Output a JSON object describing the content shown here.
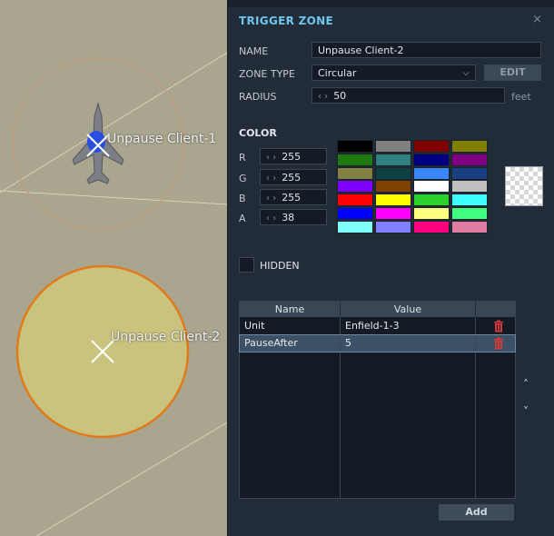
{
  "map": {
    "zones": [
      {
        "label": "Unpause Client-1"
      },
      {
        "label": "Unpause Client-2"
      }
    ]
  },
  "panel": {
    "title": "TRIGGER ZONE",
    "close_glyph": "×",
    "name_label": "NAME",
    "name_value": "Unpause Client-2",
    "zone_type_label": "ZONE TYPE",
    "zone_type_value": "Circular",
    "edit_label": "EDIT",
    "radius_label": "RADIUS",
    "radius_value": "50",
    "radius_unit": "feet",
    "color_label": "COLOR",
    "channels": [
      {
        "label": "R",
        "value": "255"
      },
      {
        "label": "G",
        "value": "255"
      },
      {
        "label": "B",
        "value": "255"
      },
      {
        "label": "A",
        "value": "38"
      }
    ],
    "palette": [
      "#000000",
      "#808080",
      "#800000",
      "#808000",
      "#1f7a12",
      "#2e8080",
      "#000080",
      "#800080",
      "#808040",
      "#0d4040",
      "#3a86ff",
      "#1a3f80",
      "#8000ff",
      "#804000",
      "#ffffff",
      "#c0c0c0",
      "#ff0000",
      "#ffff00",
      "#2ad12a",
      "#40ffff",
      "#0000ff",
      "#ff00ff",
      "#ffff80",
      "#40ff80",
      "#80ffff",
      "#8080ff",
      "#ff0080",
      "#e07aa0"
    ],
    "hidden_label": "HIDDEN",
    "table": {
      "columns": [
        "Name",
        "Value"
      ],
      "rows": [
        {
          "name": "Unit",
          "value": "Enfield-1-3"
        },
        {
          "name": "PauseAfter",
          "value": "5"
        }
      ]
    },
    "add_label": "Add",
    "accent_color": "#6ec5ee"
  }
}
